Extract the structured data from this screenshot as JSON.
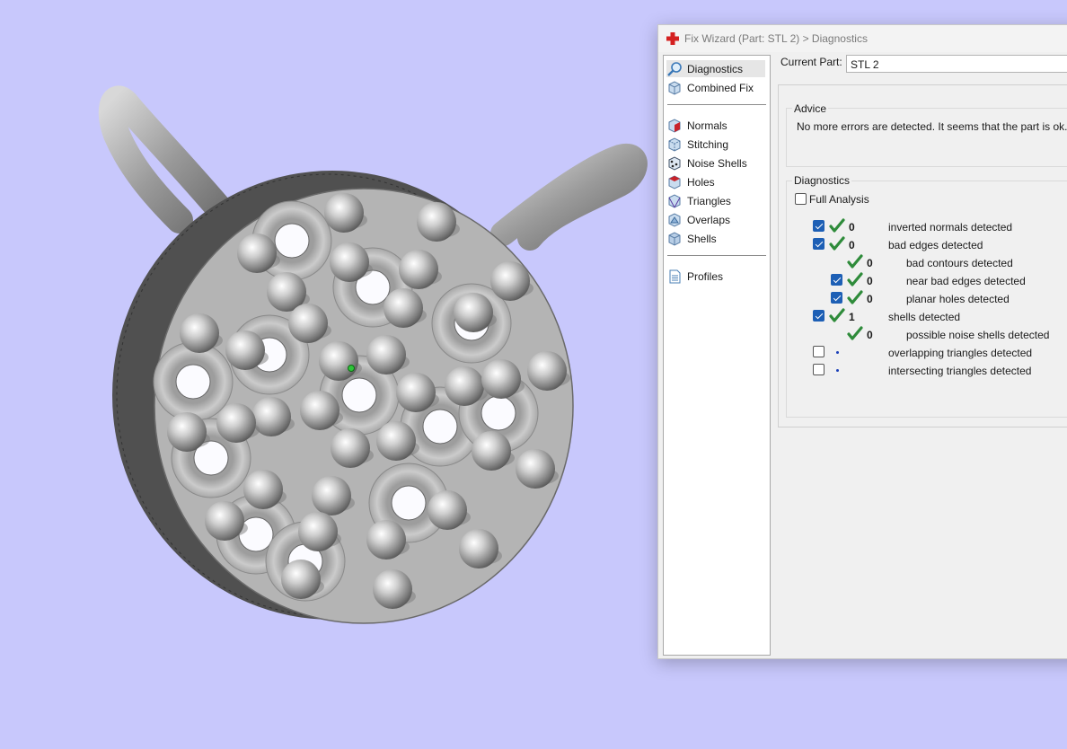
{
  "window": {
    "title": "Fix Wizard (Part: STL 2) > Diagnostics"
  },
  "nav": {
    "items": [
      {
        "label": "Diagnostics",
        "icon": "magnifier-icon",
        "selected": true
      },
      {
        "label": "Combined Fix",
        "icon": "cube-icon"
      },
      {
        "label": "Normals",
        "icon": "normals-cube-icon"
      },
      {
        "label": "Stitching",
        "icon": "stitching-icon"
      },
      {
        "label": "Noise Shells",
        "icon": "noise-shells-icon"
      },
      {
        "label": "Holes",
        "icon": "holes-cube-icon"
      },
      {
        "label": "Triangles",
        "icon": "triangles-icon"
      },
      {
        "label": "Overlaps",
        "icon": "overlaps-icon"
      },
      {
        "label": "Shells",
        "icon": "shells-icon"
      },
      {
        "label": "Profiles",
        "icon": "document-icon"
      }
    ]
  },
  "current_part": {
    "label": "Current Part:",
    "value": "STL 2"
  },
  "advice": {
    "title": "Advice",
    "text": "No more errors are detected. It seems that the part is ok. Note"
  },
  "diagnostics": {
    "title": "Diagnostics",
    "full_analysis_label": "Full Analysis",
    "full_analysis_checked": false,
    "rows": [
      {
        "checked": true,
        "status": "ok",
        "count": "0",
        "label": "inverted normals detected"
      },
      {
        "checked": true,
        "status": "ok",
        "count": "0",
        "label": "bad edges detected"
      },
      {
        "checked": null,
        "status": "ok",
        "count": "0",
        "label": "bad contours detected"
      },
      {
        "checked": true,
        "status": "ok",
        "count": "0",
        "label": "near bad edges detected"
      },
      {
        "checked": true,
        "status": "ok",
        "count": "0",
        "label": "planar holes detected"
      },
      {
        "checked": true,
        "status": "ok",
        "count": "1",
        "label": "shells detected"
      },
      {
        "checked": null,
        "status": "ok",
        "count": "0",
        "label": "possible noise shells detected"
      },
      {
        "checked": false,
        "status": "not-run",
        "count": "",
        "label": "overlapping triangles detected"
      },
      {
        "checked": false,
        "status": "not-run",
        "count": "",
        "label": "intersecting triangles detected"
      }
    ]
  },
  "colors": {
    "viewport_background": "#c8c8fc",
    "ok_tick": "#2e8b3a",
    "checkbox_blue": "#1d5fb5"
  }
}
